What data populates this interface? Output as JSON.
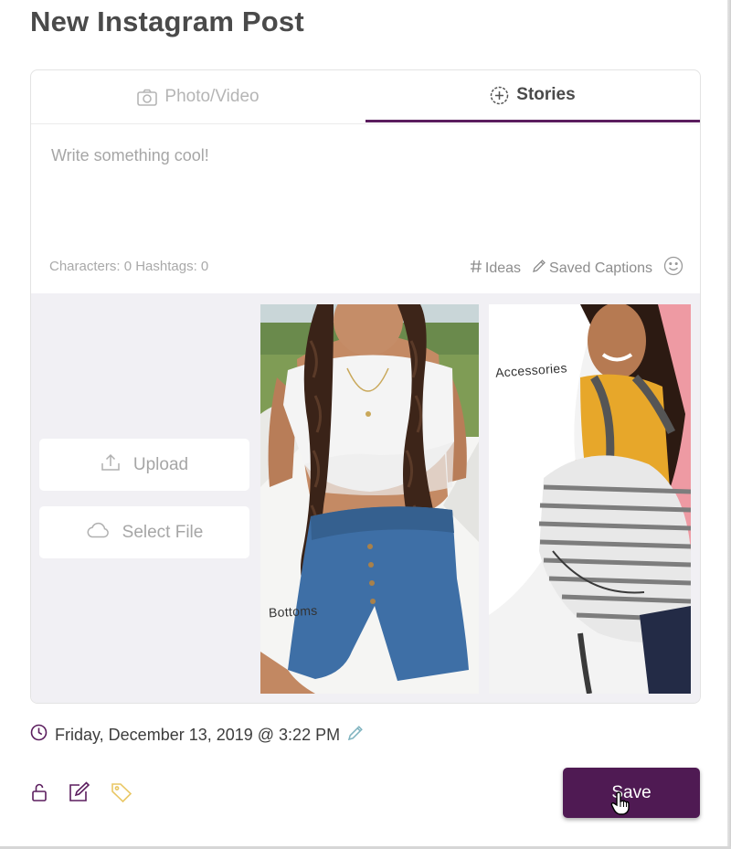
{
  "page": {
    "title": "New Instagram Post"
  },
  "tabs": [
    {
      "label": "Photo/Video",
      "icon": "camera-icon",
      "active": false
    },
    {
      "label": "Stories",
      "icon": "plus-circle-icon",
      "active": true
    }
  ],
  "caption": {
    "placeholder": "Write something cool!",
    "value": "",
    "counter": "Characters: 0 Hashtags: 0",
    "tools": {
      "ideas": "Ideas",
      "saved_captions": "Saved Captions"
    }
  },
  "media": {
    "upload_label": "Upload",
    "select_file_label": "Select File",
    "stories": [
      {
        "label": "Bottoms"
      },
      {
        "label": "Accessories"
      }
    ]
  },
  "schedule": {
    "text": "Friday, December 13, 2019 @ 3:22 PM"
  },
  "footer": {
    "save_label": "Save"
  },
  "colors": {
    "accent": "#5b1d5e",
    "save_button": "#4f1a53",
    "tag_icon": "#e9c765",
    "edit_pencil": "#7fb3bf",
    "media_background": "#f1f0f4"
  }
}
